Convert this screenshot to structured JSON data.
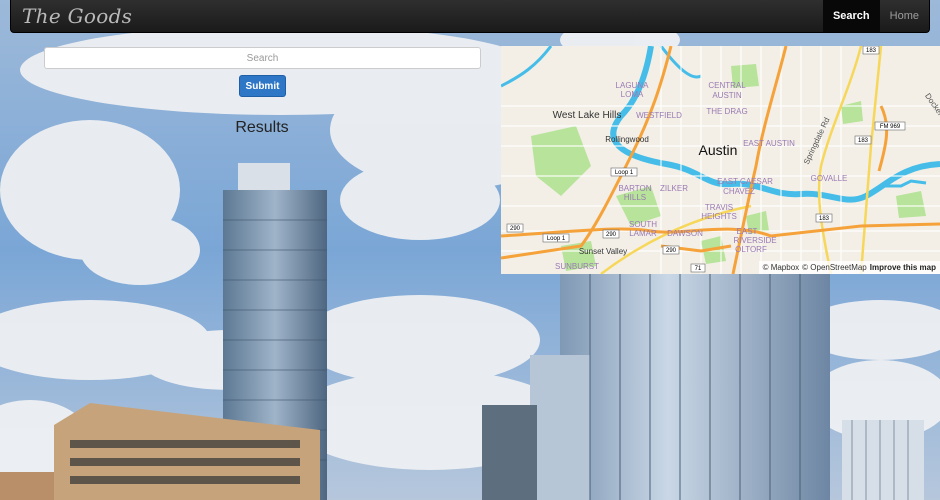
{
  "navbar": {
    "brand": "The Goods",
    "links": [
      {
        "label": "Search",
        "active": true
      },
      {
        "label": "Home",
        "active": false
      }
    ]
  },
  "search": {
    "placeholder": "Search",
    "value": "",
    "submit_label": "Submit"
  },
  "results": {
    "title": "Results"
  },
  "map": {
    "city_label": "Austin",
    "places": [
      "West Lake Hills",
      "Rollingwood",
      "LAGUNA",
      "LOMA",
      "WESTFIELD",
      "CENTRAL",
      "AUSTIN",
      "THE DRAG",
      "EAST AUSTIN",
      "EAST CAESAR",
      "CHAVEZ",
      "GOVALLE",
      "BARTON",
      "HILLS",
      "ZILKER",
      "TRAVIS",
      "HEIGHTS",
      "SOUTH",
      "LAMAR",
      "DAWSON",
      "EAST",
      "RIVERSIDE",
      "OLTORF",
      "Sunset Valley",
      "SUNBURST",
      "Springdale Rd",
      "Docker"
    ],
    "shields": [
      "183",
      "183",
      "183",
      "FM 969",
      "Loop 1",
      "Loop 1",
      "290",
      "290",
      "290",
      "71",
      "71",
      "183"
    ],
    "attribution": {
      "mapbox": "© Mapbox",
      "osm": "© OpenStreetMap",
      "improve": "Improve this map"
    },
    "colors": {
      "land": "#f3efe6",
      "water": "#46bde8",
      "park": "#b7e39a",
      "highway": "#f5a23a",
      "major_road": "#f7d75a"
    }
  }
}
